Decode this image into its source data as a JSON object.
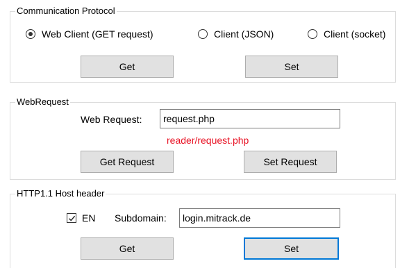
{
  "communication_protocol": {
    "title": "Communication Protocol",
    "options": [
      {
        "label": "Web Client (GET request)",
        "selected": true
      },
      {
        "label": "Client (JSON)",
        "selected": false
      },
      {
        "label": "Client (socket)",
        "selected": false
      }
    ],
    "get_label": "Get",
    "set_label": "Set"
  },
  "web_request": {
    "title": "WebRequest",
    "field_label": "Web Request:",
    "field_value": "request.php",
    "hint_text": "reader/request.php",
    "hint_color": "#e81123",
    "get_label": "Get Request",
    "set_label": "Set Request"
  },
  "host_header": {
    "title": "HTTP1.1 Host header",
    "enable_label": "EN",
    "enable_checked": true,
    "subdomain_label": "Subdomain:",
    "subdomain_value": "login.mitrack.de",
    "get_label": "Get",
    "set_label": "Set"
  },
  "colors": {
    "focus": "#0078d7",
    "button_face": "#e1e1e1",
    "group_border": "#dcdcdc"
  },
  "icons": {
    "checkbox_mark": "checkmark-icon",
    "radio_dot": "radio-dot-icon"
  }
}
